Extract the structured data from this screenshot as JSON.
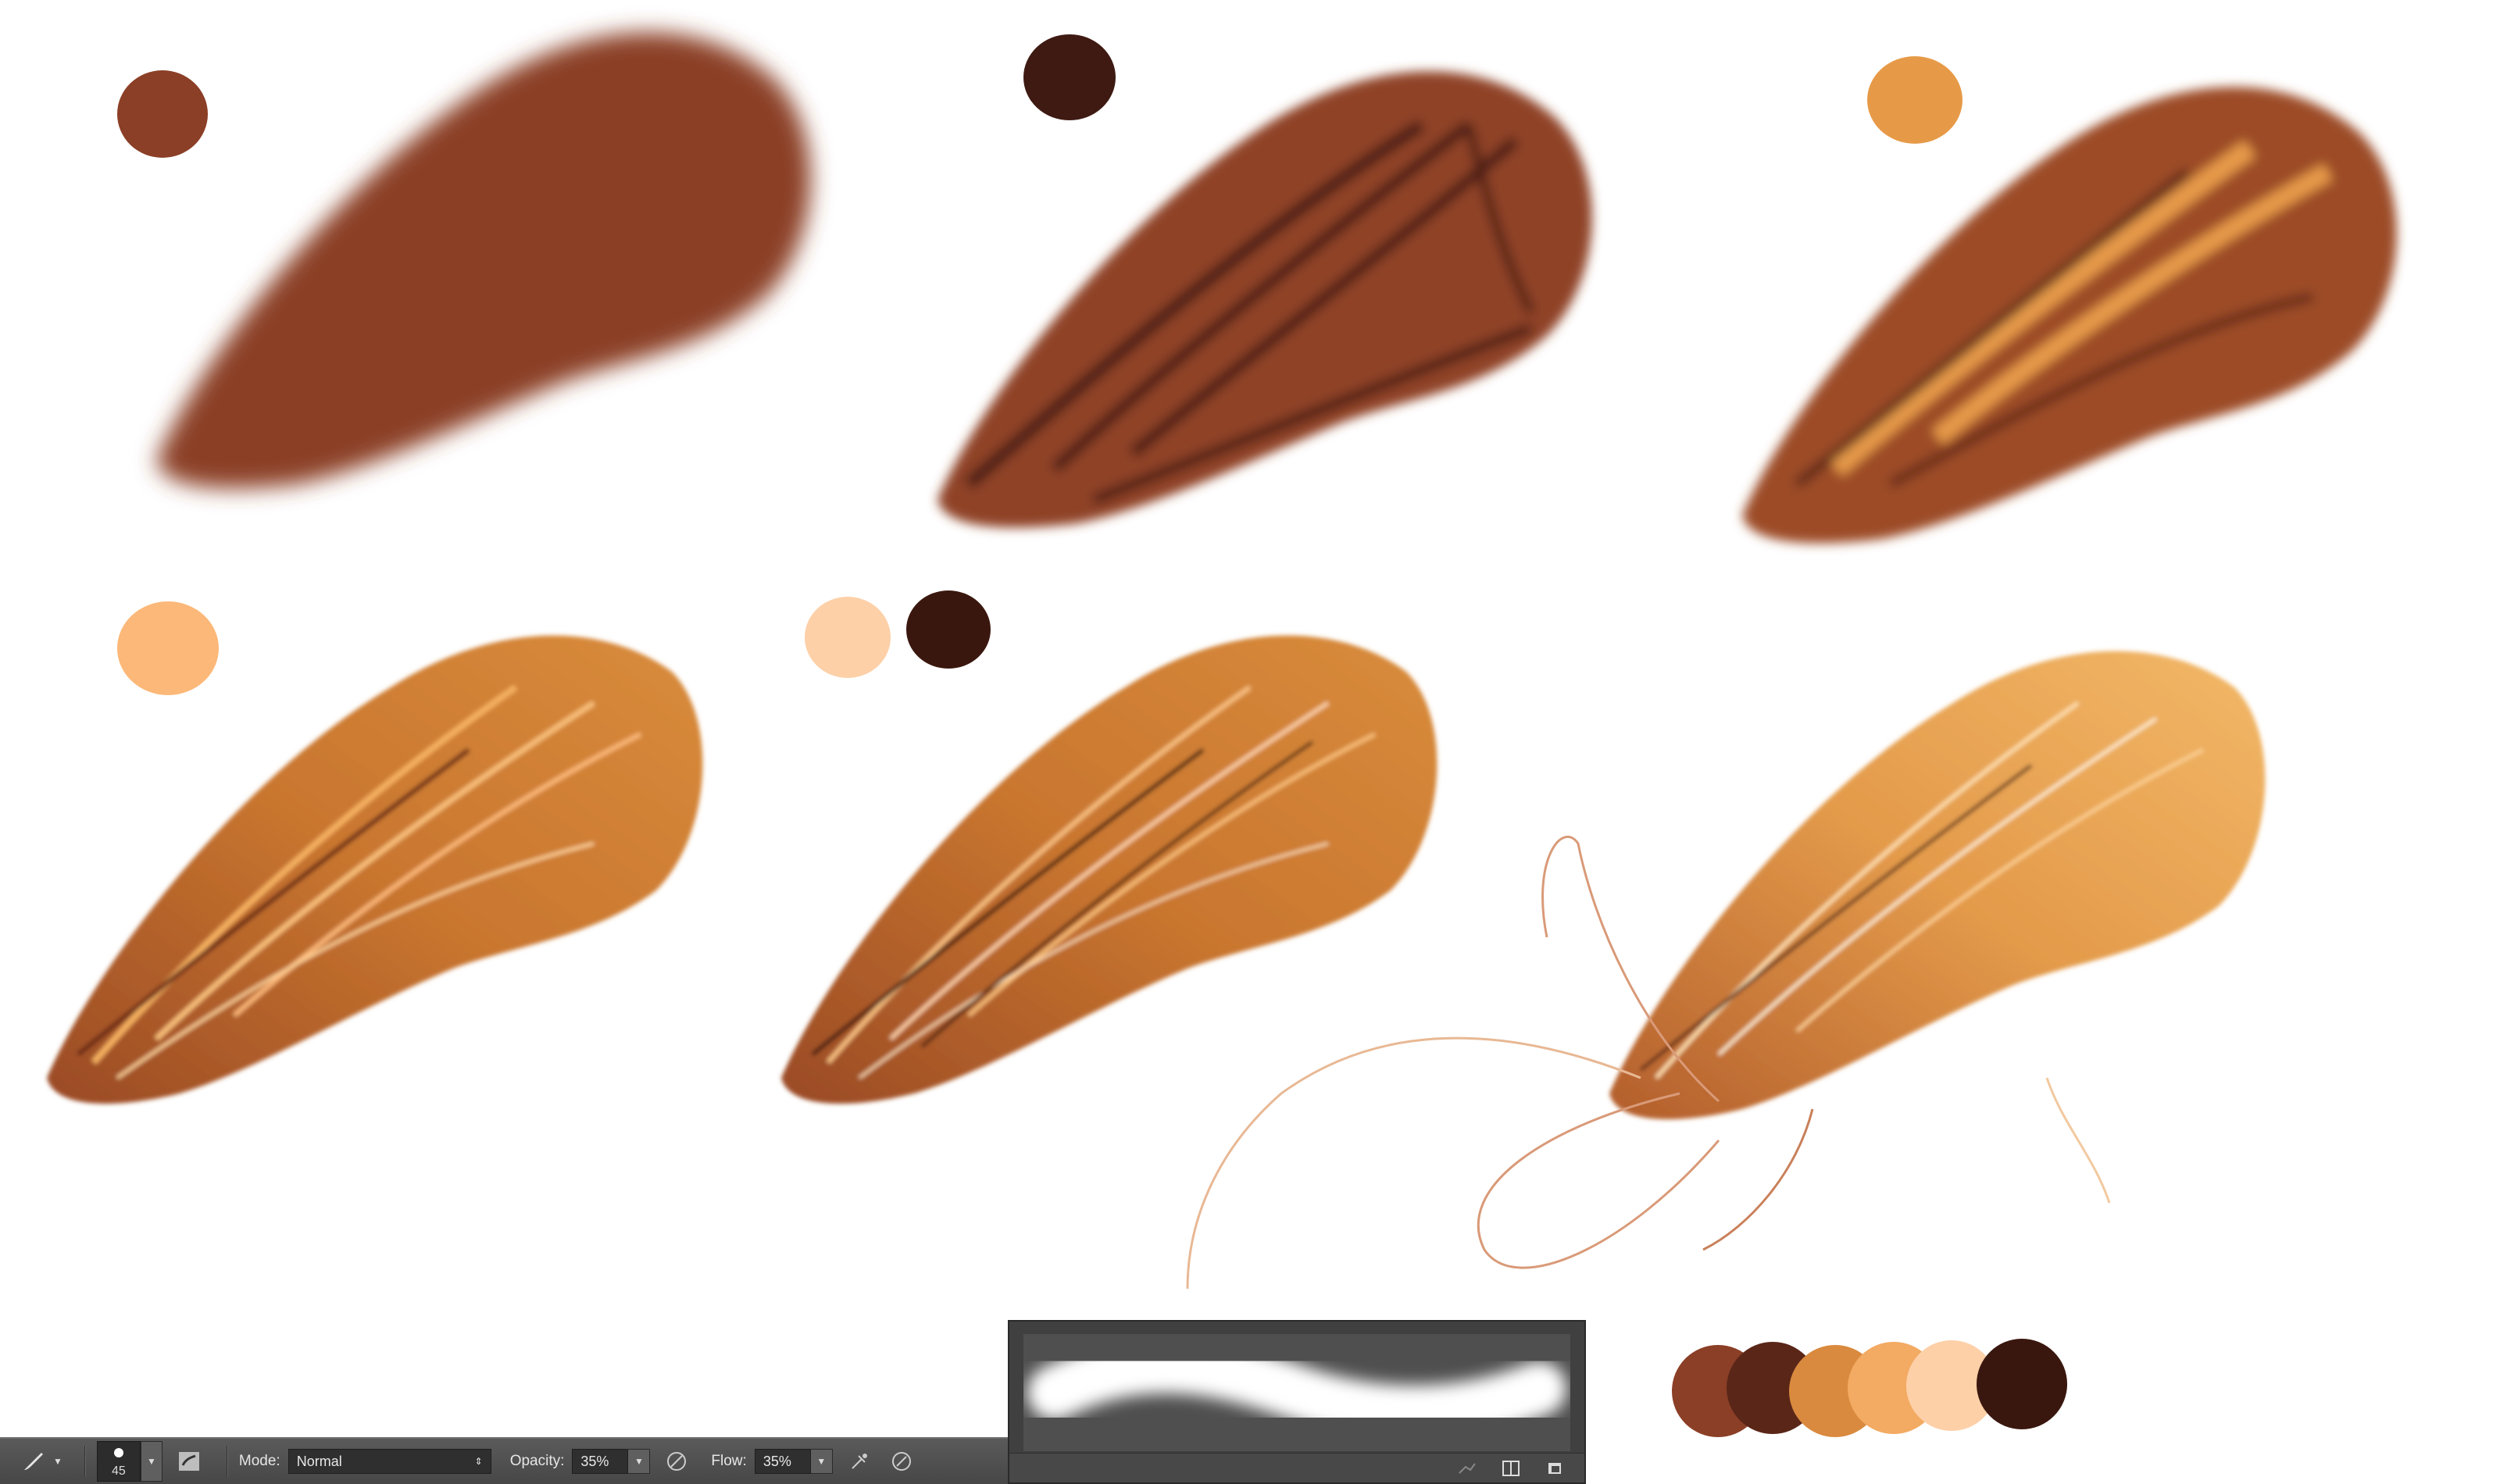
{
  "options_bar": {
    "tool_icon": "brush-tool-icon",
    "brush_size": "45",
    "mode_label": "Mode:",
    "mode_value": "Normal",
    "opacity_label": "Opacity:",
    "opacity_value": "35%",
    "flow_label": "Flow:",
    "flow_value": "35%"
  },
  "swatches": {
    "step1": [
      "#8b3f26"
    ],
    "step2": [
      "#3e1a12"
    ],
    "step3": [
      "#e69a48"
    ],
    "step4": [
      "#fcb878"
    ],
    "step5": [
      "#fdd0a8",
      "#3a170e"
    ],
    "palette": [
      "#8b3f26",
      "#5a2618",
      "#d98a3e",
      "#f3aa62",
      "#fdd0a8",
      "#3a170e"
    ]
  }
}
